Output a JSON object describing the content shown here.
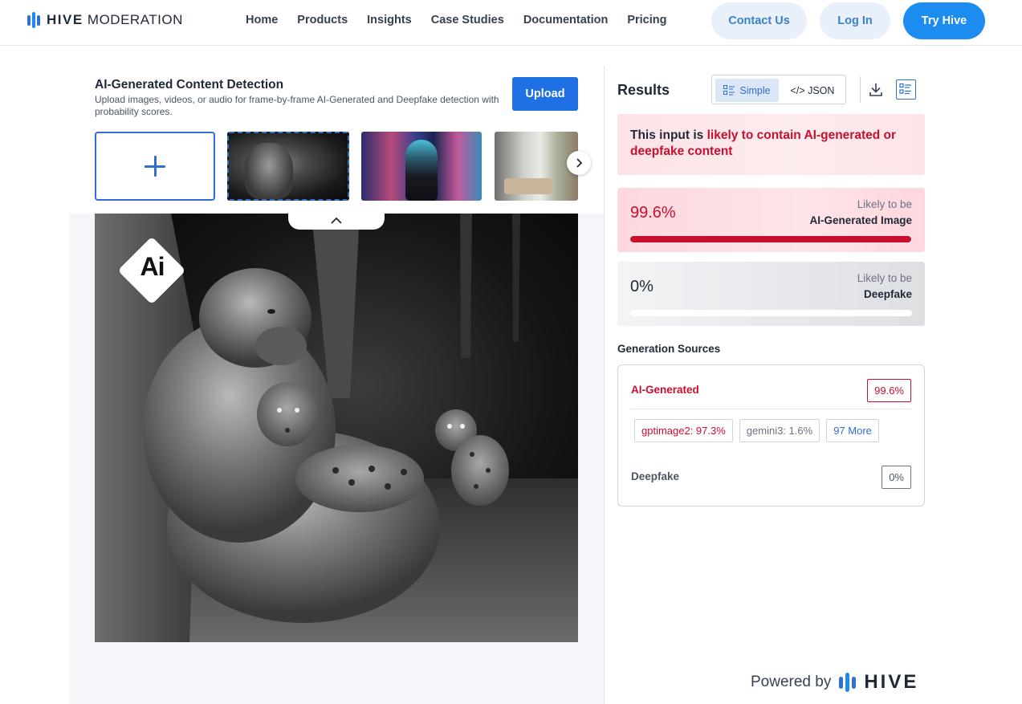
{
  "brand": {
    "name_bold": "HIVE",
    "name_light": " MODERATION",
    "bar_colors": [
      "#2f6fd1",
      "#1d8cf0",
      "#2f6fd1"
    ]
  },
  "nav": {
    "links": [
      "Home",
      "Products",
      "Insights",
      "Case Studies",
      "Documentation",
      "Pricing"
    ],
    "contact_label": "Contact Us",
    "login_label": "Log In",
    "try_label": "Try Hive"
  },
  "detector": {
    "title": "AI-Generated Content Detection",
    "description": "Upload images, videos, or audio for frame-by-frame AI-Generated and Deepfake detection with probability scores.",
    "upload_label": "Upload",
    "selected_thumbnail": 1,
    "ai_badge_text": "Ai"
  },
  "results": {
    "title": "Results",
    "view_simple": "Simple",
    "view_json": "</> JSON",
    "active_view": "Simple",
    "alert_prefix": "This input is ",
    "alert_strong": "likely to contain AI-generated or deepfake content",
    "scores": [
      {
        "value_text": "99.6%",
        "value": 0.996,
        "likely": "Likely to be",
        "category": "AI-Generated Image"
      },
      {
        "value_text": "0%",
        "value": 0.0,
        "likely": "Likely to be",
        "category": "Deepfake"
      }
    ]
  },
  "generation_sources": {
    "title": "Generation Sources",
    "ai_label": "AI-Generated",
    "ai_value": "99.6%",
    "chips": [
      {
        "text": "gptimage2: 97.3%",
        "tone": "red"
      },
      {
        "text": "gemini3: 1.6%",
        "tone": "gray"
      },
      {
        "text": "97 More",
        "tone": "blue"
      }
    ],
    "deepfake_label": "Deepfake",
    "deepfake_value": "0%"
  },
  "footer": {
    "powered_by": "Powered by",
    "brand": "HIVE"
  },
  "colors": {
    "accent": "#1f6fe5",
    "danger": "#c8102e",
    "nav_pill_bg": "#e8f1fb"
  }
}
